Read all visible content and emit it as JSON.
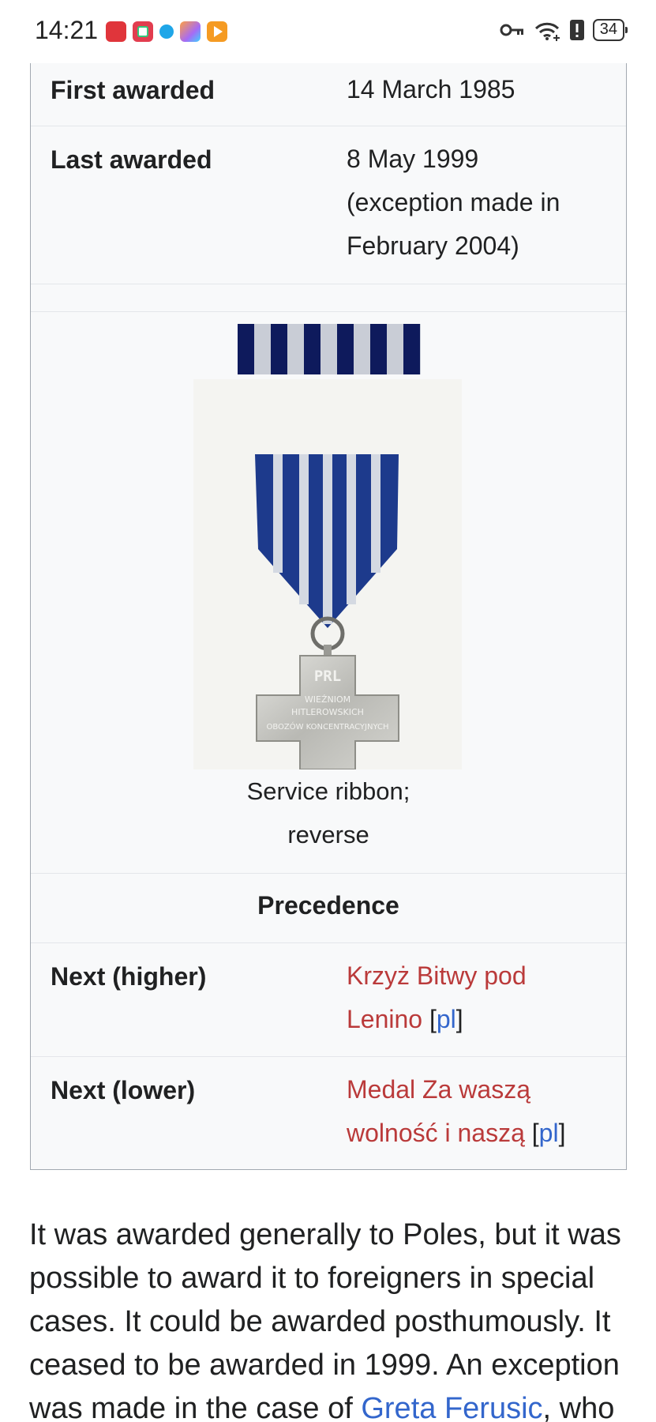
{
  "status_bar": {
    "time": "14:21",
    "battery": "34",
    "icons": [
      "key-icon",
      "wifi-icon",
      "alert-icon",
      "battery-icon"
    ]
  },
  "infobox": {
    "first_awarded": {
      "label": "First awarded",
      "value": "14 March 1985"
    },
    "last_awarded": {
      "label": "Last awarded",
      "value_line1": "8 May 1999",
      "value_line2": "(exception made in",
      "value_line3": "February 2004)"
    },
    "medal_engraving": {
      "line1": "PRL",
      "line2": "WIEŹNIOM",
      "line3": "HITLEROWSKICH",
      "line4": "OBOZÓW KONCENTRACYJNYCH"
    },
    "caption_line1": "Service ribbon;",
    "caption_line2": "reverse",
    "precedence": "Precedence",
    "next_higher": {
      "label": "Next (higher)",
      "link_line1": "Krzyż Bitwy pod",
      "link_line2": "Lenino",
      "bracket_open": " [",
      "lang": "pl",
      "bracket_close": "]"
    },
    "next_lower": {
      "label": "Next (lower)",
      "link_line1": "Medal Za waszą",
      "link_line2": "wolność i naszą",
      "bracket_open": " [",
      "lang": "pl",
      "bracket_close": "]"
    }
  },
  "paragraph": {
    "text": "It was awarded generally to Poles, but it was possible to award it to foreigners in special cases. It could be awarded posthumously. It ceased to be awarded in 1999. An exception was made in the case of ",
    "link": "Greta Ferusic",
    "text_after": ", who"
  },
  "colors": {
    "link_red": "#ba3a3a",
    "link_blue": "#3366cc",
    "infobox_bg": "#f8f9fa",
    "ribbon_navy": "#0e1a5c"
  }
}
